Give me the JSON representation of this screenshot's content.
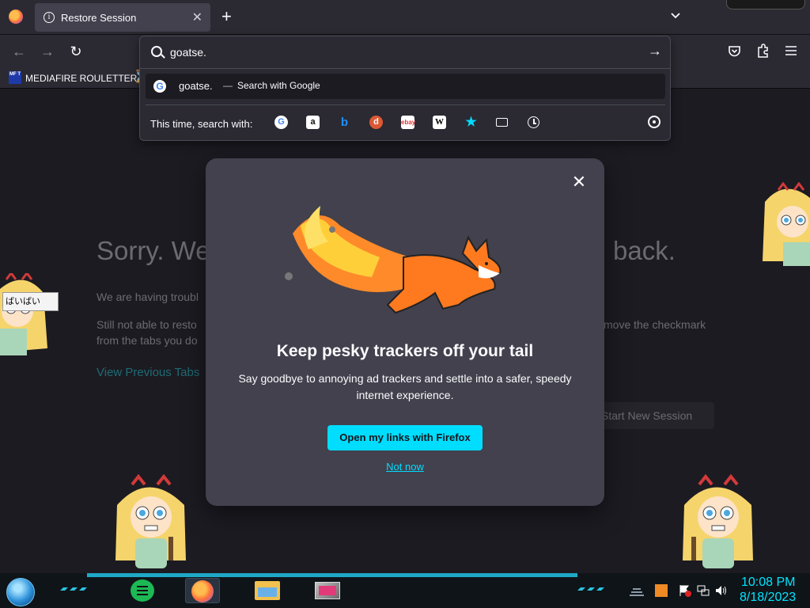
{
  "tabs": [
    {
      "title": "Restore Session"
    }
  ],
  "urlbar": {
    "query": "goatse.",
    "suggestion": {
      "query": "goatse.",
      "dash": "—",
      "action": "Search with Google"
    },
    "one_off_label": "This time, search with:",
    "engines": [
      "google-icon",
      "amazon-icon",
      "bing-icon",
      "duckduckgo-icon",
      "ebay-icon",
      "wikipedia-icon",
      "bookmarks-star-icon",
      "tabs-icon",
      "history-icon"
    ]
  },
  "bookmarks": [
    {
      "label": "MEDIAFIRE ROULETTER",
      "icon_text": "MF T"
    }
  ],
  "page": {
    "heading_start": "Sorry. We’",
    "heading_end": "back.",
    "line1": "We are having troubl",
    "line2": "Still not able to resto",
    "line2b": "from the tabs you do",
    "line3": "move the checkmark",
    "view_previous": "View Previous Tabs",
    "start_new": "Start New Session"
  },
  "modal": {
    "title": "Keep pesky trackers off your tail",
    "subtitle": "Say goodbye to annoying ad trackers and settle into a safer, speedy internet experience.",
    "primary_button": "Open my links with Firefox",
    "secondary_link": "Not now"
  },
  "desktop": {
    "sticker_label": "ばいばい"
  },
  "taskbar": {
    "time": "10:08 PM",
    "date": "8/18/2023"
  },
  "colors": {
    "accent": "#00ddff",
    "clock": "#00e5ff",
    "modal_bg": "#42414d",
    "page_bg": "#1c1b22"
  }
}
